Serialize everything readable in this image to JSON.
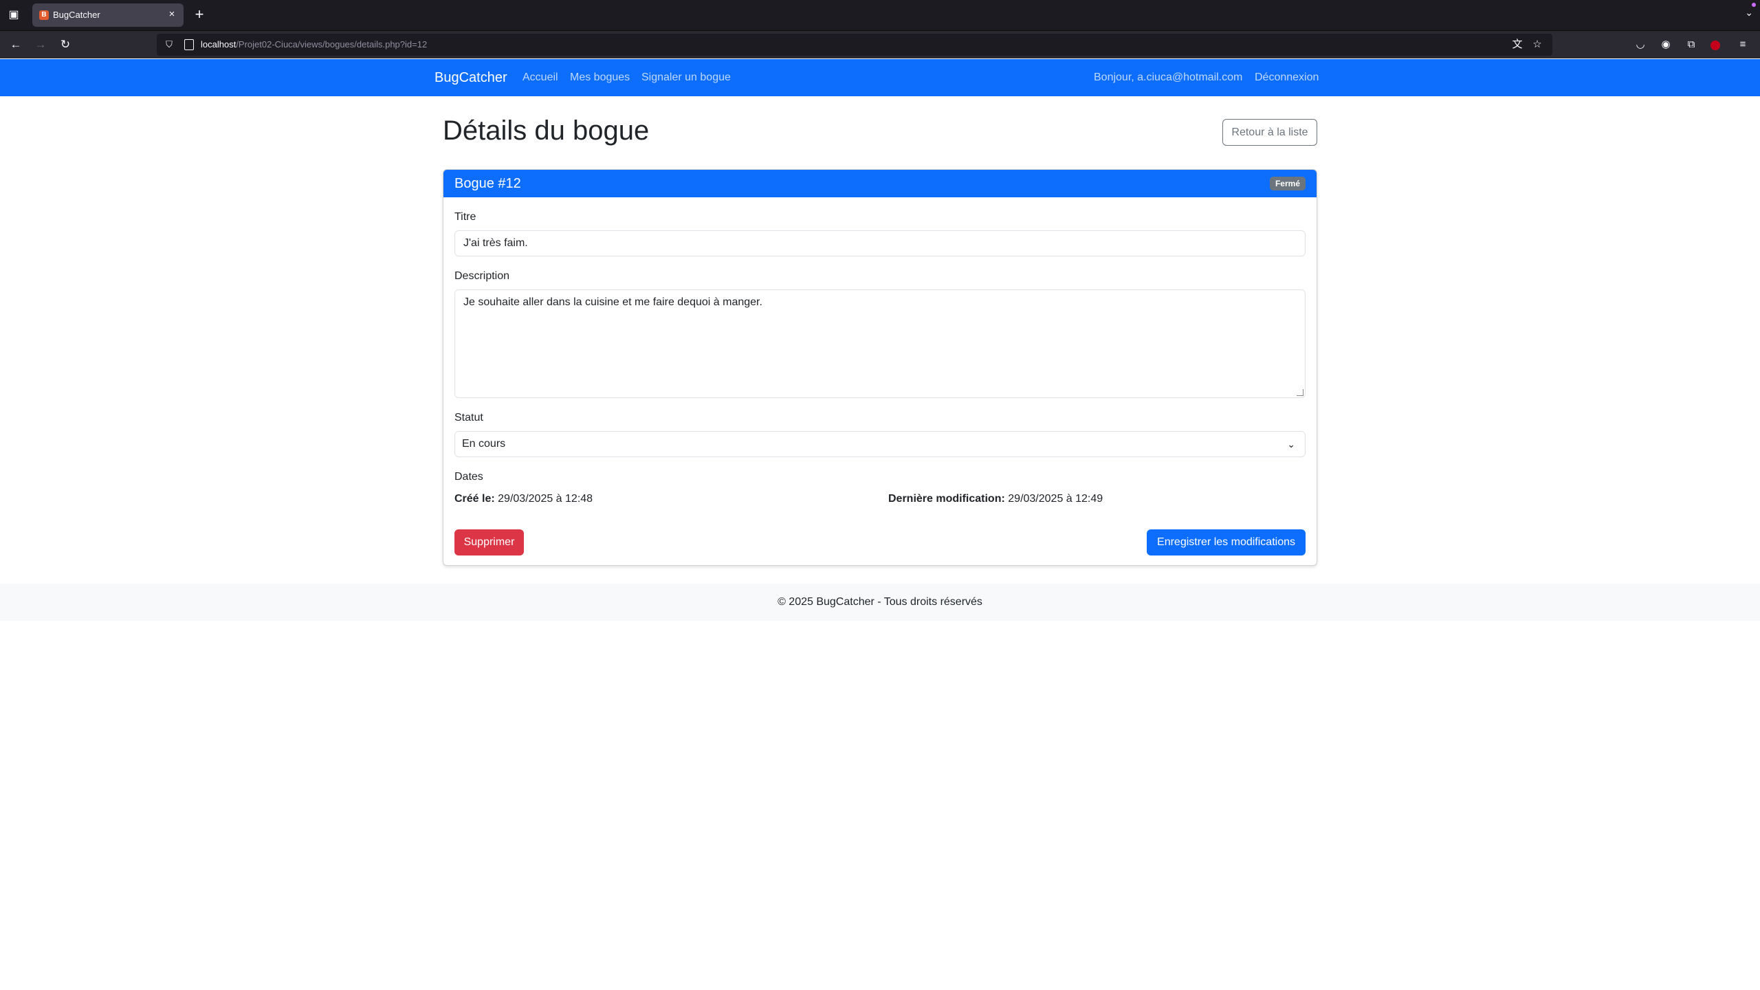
{
  "browser": {
    "tab_title": "BugCatcher",
    "favicon_letter": "B",
    "url_host": "localhost",
    "url_path": "/Projet02-Ciuca/views/bogues/details.php?id=12"
  },
  "site_nav": {
    "brand": "BugCatcher",
    "links": [
      "Accueil",
      "Mes bogues",
      "Signaler un bogue"
    ],
    "greeting": "Bonjour, a.ciuca@hotmail.com",
    "logout": "Déconnexion"
  },
  "page": {
    "title": "Détails du bogue",
    "back_button": "Retour à la liste"
  },
  "bug": {
    "header": "Bogue #12",
    "status_badge": "Fermé",
    "title_label": "Titre",
    "title_value": "J'ai très faim.",
    "description_label": "Description",
    "description_value": "Je souhaite aller dans la cuisine et me faire dequoi à manger.",
    "status_label": "Statut",
    "status_selected": "En cours",
    "dates_label": "Dates",
    "created_label": "Créé le:",
    "created_value": "29/03/2025 à 12:48",
    "modified_label": "Dernière modification:",
    "modified_value": "29/03/2025 à 12:49",
    "delete_button": "Supprimer",
    "save_button": "Enregistrer les modifications"
  },
  "footer": {
    "text": "© 2025 BugCatcher - Tous droits réservés"
  },
  "colors": {
    "primary": "#0d6efd",
    "danger": "#dc3545",
    "secondary": "#6c757d",
    "footer_bg": "#f8f9fa"
  }
}
